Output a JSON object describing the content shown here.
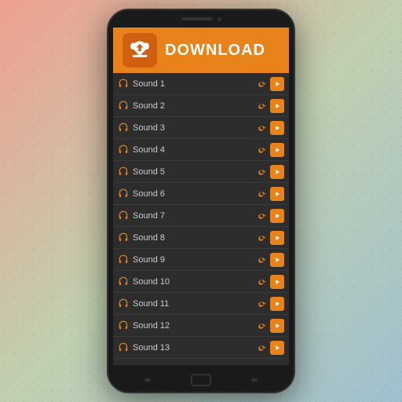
{
  "banner": {
    "download_label": "DOWNLOAD"
  },
  "sounds": [
    {
      "id": 1,
      "name": "Sound 1"
    },
    {
      "id": 2,
      "name": "Sound 2"
    },
    {
      "id": 3,
      "name": "Sound 3"
    },
    {
      "id": 4,
      "name": "Sound 4"
    },
    {
      "id": 5,
      "name": "Sound 5"
    },
    {
      "id": 6,
      "name": "Sound 6"
    },
    {
      "id": 7,
      "name": "Sound 7"
    },
    {
      "id": 8,
      "name": "Sound 8"
    },
    {
      "id": 9,
      "name": "Sound 9"
    },
    {
      "id": 10,
      "name": "Sound 10"
    },
    {
      "id": 11,
      "name": "Sound 11"
    },
    {
      "id": 12,
      "name": "Sound 12"
    },
    {
      "id": 13,
      "name": "Sound 13"
    }
  ],
  "colors": {
    "accent": "#e8821a"
  }
}
